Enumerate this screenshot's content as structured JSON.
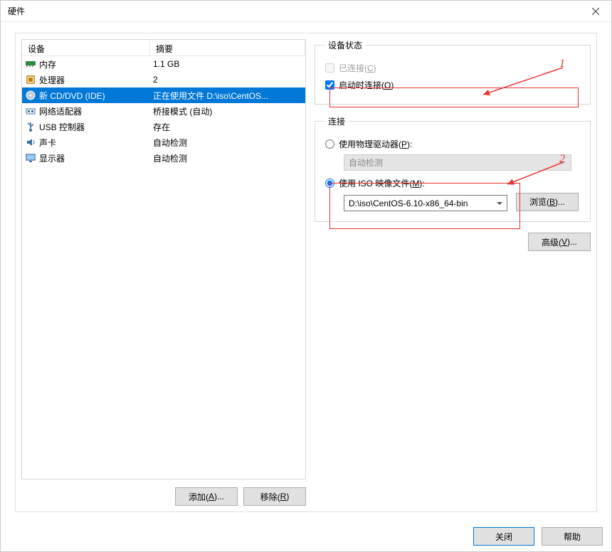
{
  "window": {
    "title": "硬件"
  },
  "list": {
    "header_device": "设备",
    "header_summary": "摘要",
    "rows": [
      {
        "icon": "memory",
        "device": "内存",
        "summary": "1.1 GB"
      },
      {
        "icon": "cpu",
        "device": "处理器",
        "summary": "2"
      },
      {
        "icon": "cd",
        "device": "新 CD/DVD (IDE)",
        "summary": "正在使用文件 D:\\iso\\CentOS...",
        "selected": true
      },
      {
        "icon": "net",
        "device": "网络适配器",
        "summary": "桥接模式 (自动)"
      },
      {
        "icon": "usb",
        "device": "USB 控制器",
        "summary": "存在"
      },
      {
        "icon": "sound",
        "device": "声卡",
        "summary": "自动检测"
      },
      {
        "icon": "display",
        "device": "显示器",
        "summary": "自动检测"
      }
    ]
  },
  "buttons": {
    "add": "添加(",
    "add_u": "A",
    "add_tail": ")...",
    "remove": "移除(",
    "remove_u": "R",
    "remove_tail": ")",
    "browse": "浏览(",
    "browse_u": "B",
    "browse_tail": ")...",
    "advanced": "高级(",
    "advanced_u": "V",
    "advanced_tail": ")...",
    "close": "关闭",
    "help": "帮助"
  },
  "device_state": {
    "legend": "设备状态",
    "connected": "已连接(",
    "connected_u": "C",
    "connected_tail": ")",
    "connect_on_start": "启动时连接(",
    "connect_on_start_u": "O",
    "connect_on_start_tail": ")"
  },
  "connection": {
    "legend": "连接",
    "physical": "使用物理驱动器(",
    "physical_u": "P",
    "physical_tail": "):",
    "physical_value": "自动检测",
    "iso": "使用 ISO 映像文件(",
    "iso_u": "M",
    "iso_tail": "):",
    "iso_path": "D:\\iso\\CentOS-6.10-x86_64-bin"
  },
  "annotations": {
    "one": "1",
    "two": "2"
  }
}
